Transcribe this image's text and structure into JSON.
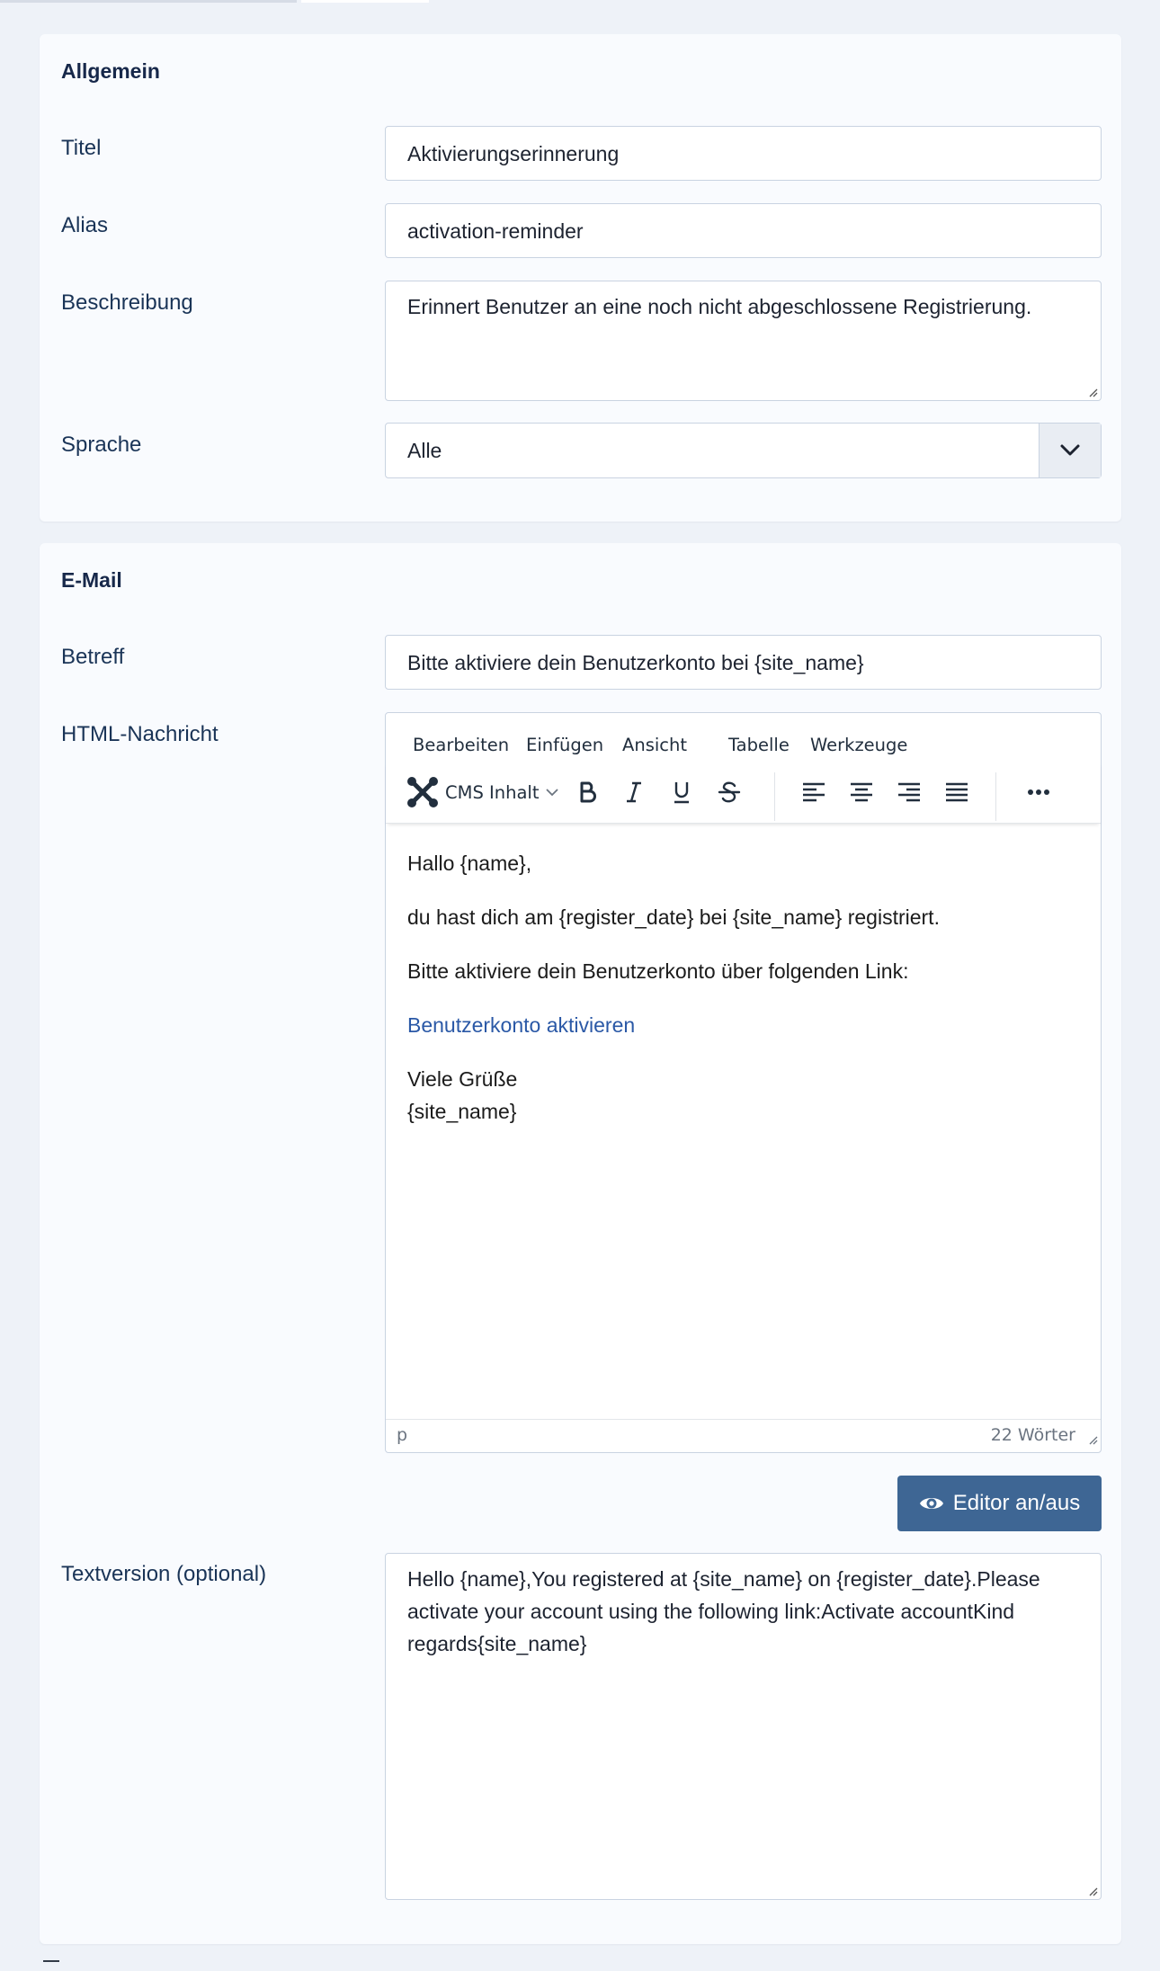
{
  "general": {
    "title": "Allgemein",
    "title_label": "Titel",
    "title_value": "Aktivierungserinnerung",
    "alias_label": "Alias",
    "alias_value": "activation-reminder",
    "description_label": "Beschreibung",
    "description_value": "Erinnert Benutzer an eine noch nicht abgeschlossene Registrierung.",
    "language_label": "Sprache",
    "language_value": "Alle"
  },
  "email": {
    "title": "E-Mail",
    "subject_label": "Betreff",
    "subject_value": "Bitte aktiviere dein Benutzerkonto bei {site_name}",
    "html_label": "HTML-Nachricht",
    "editor": {
      "menu": [
        "Bearbeiten",
        "Einfügen",
        "Ansicht",
        "Tabelle",
        "Werkzeuge"
      ],
      "cms_content": "CMS Inhalt",
      "icons": [
        "joomla-icon",
        "bold-icon",
        "italic-icon",
        "underline-icon",
        "strikethrough-icon",
        "align-left-icon",
        "align-center-icon",
        "align-right-icon",
        "align-justify-icon",
        "more-icon"
      ],
      "content": {
        "greeting": "Hallo {name},",
        "line1": "du hast dich am {register_date} bei {site_name} registriert.",
        "line2": "Bitte aktiviere dein Benutzerkonto über folgenden Link:",
        "link": "Benutzerkonto aktivieren",
        "closing1": "Viele Grüße",
        "closing2": "{site_name}"
      },
      "status_path": "p",
      "word_count": "22 Wörter"
    },
    "toggle_label": "Editor an/aus",
    "text_label": "Textversion (optional)",
    "text_value": "Hello {name},You registered at {site_name} on {register_date}.Please activate your account using the following link:Activate accountKind regards{site_name}"
  },
  "colors": {
    "accent": "#3e6694",
    "link": "#2a58a6"
  }
}
